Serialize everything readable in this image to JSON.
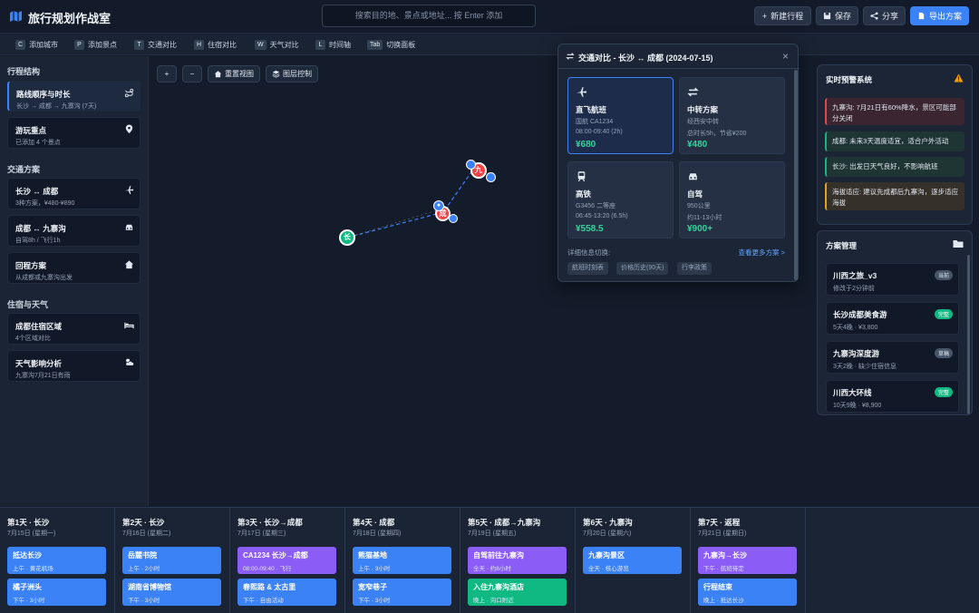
{
  "header": {
    "title": "旅行规划作战室",
    "search_placeholder": "搜索目的地、景点或地址... 按 Enter 添加",
    "buttons": {
      "new": "新建行程",
      "save": "保存",
      "share": "分享",
      "export": "导出方案"
    }
  },
  "shortcuts": [
    {
      "key": "C",
      "label": "添加城市"
    },
    {
      "key": "P",
      "label": "添加景点"
    },
    {
      "key": "T",
      "label": "交通对比"
    },
    {
      "key": "H",
      "label": "住宿对比"
    },
    {
      "key": "W",
      "label": "天气对比"
    },
    {
      "key": "L",
      "label": "时间轴"
    },
    {
      "key": "Tab",
      "label": "切换面板"
    }
  ],
  "left": {
    "sections": [
      "行程结构",
      "交通方案",
      "住宿与天气"
    ],
    "cards": [
      {
        "title": "路线顺序与时长",
        "sub": "长沙 → 成都 → 九寨沟 (7天)",
        "icon": "route-icon"
      },
      {
        "title": "游玩重点",
        "sub": "已添加 4 个景点",
        "icon": "pin-icon"
      },
      {
        "title": "长沙 ↔ 成都",
        "sub": "3种方案，¥480-¥890",
        "icon": "plane-icon"
      },
      {
        "title": "成都 ↔ 九寨沟",
        "sub": "自驾8h / 飞行1h",
        "icon": "car-icon"
      },
      {
        "title": "回程方案",
        "sub": "从成都或九寨沟出发",
        "icon": "home-icon"
      },
      {
        "title": "成都住宿区域",
        "sub": "4个区域对比",
        "icon": "bed-icon"
      },
      {
        "title": "天气影响分析",
        "sub": "九寨沟7月21日有雨",
        "icon": "weather-icon"
      }
    ]
  },
  "map": {
    "zoom_in": "+",
    "zoom_out": "−",
    "reset": "重置视图",
    "layers": "图层控制",
    "markers": {
      "changsha": "长",
      "chengdu": "成",
      "jiuzhai": "九"
    }
  },
  "popup": {
    "title": "交通对比 - 长沙 ↔ 成都 (2024-07-15)",
    "close": "×",
    "options": [
      {
        "name": "直飞航班",
        "l1": "国航 CA1234",
        "l2": "08:00-09:40 (2h)",
        "price": "¥680",
        "icon": "plane-icon"
      },
      {
        "name": "中转方案",
        "l1": "经西安中转",
        "l2": "总时长5h，节省¥200",
        "price": "¥480",
        "icon": "transfer-icon"
      },
      {
        "name": "高铁",
        "l1": "G3456 二等座",
        "l2": "06:45-13:20 (6.5h)",
        "price": "¥558.5",
        "icon": "train-icon"
      },
      {
        "name": "自驾",
        "l1": "950公里",
        "l2": "约11-13小时",
        "price": "¥900+",
        "icon": "car-icon"
      }
    ],
    "detail_label": "详细信息切换:",
    "more": "查看更多方案 >",
    "chips": [
      "航班时刻表",
      "价格历史(90天)",
      "行李政策"
    ]
  },
  "alerts": {
    "title": "实时预警系统",
    "items": [
      {
        "text": "九寨沟: 7月21日有60%降水，景区可能部分关闭",
        "level": "danger"
      },
      {
        "text": "成都: 未来3天温度适宜，适合户外活动",
        "level": "success"
      },
      {
        "text": "长沙: 出发日天气良好，不影响航班",
        "level": "success"
      },
      {
        "text": "海拔适应: 建议先成都后九寨沟，逐步适应海拔",
        "level": "warning"
      }
    ]
  },
  "plans": {
    "title": "方案管理",
    "items": [
      {
        "name": "川西之旅_v3",
        "desc": "修改于2分钟前",
        "badge": "当前",
        "badge_color": "#475569"
      },
      {
        "name": "长沙成都美食游",
        "desc": "5天4晚 · ¥3,800",
        "badge": "完整",
        "badge_color": "#10b981"
      },
      {
        "name": "九寨沟深度游",
        "desc": "3天2晚 · 缺少住宿信息",
        "badge": "草稿",
        "badge_color": "#475569"
      },
      {
        "name": "川西大环线",
        "desc": "10天9晚 · ¥8,900",
        "badge": "完整",
        "badge_color": "#10b981"
      }
    ]
  },
  "days": [
    {
      "title": "第1天 · 长沙",
      "date": "7月15日 (星期一)",
      "events": [
        {
          "name": "抵达长沙",
          "sub": "上午 · 黄花机场",
          "color": "blue"
        },
        {
          "name": "橘子洲头",
          "sub": "下午 · 3小时",
          "color": "blue"
        }
      ]
    },
    {
      "title": "第2天 · 长沙",
      "date": "7月16日 (星期二)",
      "events": [
        {
          "name": "岳麓书院",
          "sub": "上午 · 2小时",
          "color": "blue"
        },
        {
          "name": "湖南省博物馆",
          "sub": "下午 · 3小时",
          "color": "blue"
        }
      ]
    },
    {
      "title": "第3天 · 长沙→成都",
      "date": "7月17日 (星期三)",
      "events": [
        {
          "name": "CA1234 长沙→成都",
          "sub": "08:00-09:40 · 飞行",
          "color": "purple"
        },
        {
          "name": "春熙路 & 太古里",
          "sub": "下午 · 自由活动",
          "color": "blue"
        }
      ]
    },
    {
      "title": "第4天 · 成都",
      "date": "7月18日 (星期四)",
      "events": [
        {
          "name": "熊猫基地",
          "sub": "上午 · 3小时",
          "color": "blue"
        },
        {
          "name": "宽窄巷子",
          "sub": "下午 · 3小时",
          "color": "blue"
        }
      ]
    },
    {
      "title": "第5天 · 成都→九寨沟",
      "date": "7月19日 (星期五)",
      "events": [
        {
          "name": "自驾前往九寨沟",
          "sub": "全天 · 约8小时",
          "color": "purple"
        },
        {
          "name": "入住九寨沟酒店",
          "sub": "晚上 · 沟口附近",
          "color": "green"
        }
      ]
    },
    {
      "title": "第6天 · 九寨沟",
      "date": "7月20日 (星期六)",
      "events": [
        {
          "name": "九寨沟景区",
          "sub": "全天 · 核心游览",
          "color": "blue"
        }
      ]
    },
    {
      "title": "第7天 · 返程",
      "date": "7月21日 (星期日)",
      "events": [
        {
          "name": "九寨沟→长沙",
          "sub": "下午 · 航班待定",
          "color": "purple"
        },
        {
          "name": "行程结束",
          "sub": "晚上 · 抵达长沙",
          "color": "blue"
        }
      ]
    }
  ]
}
